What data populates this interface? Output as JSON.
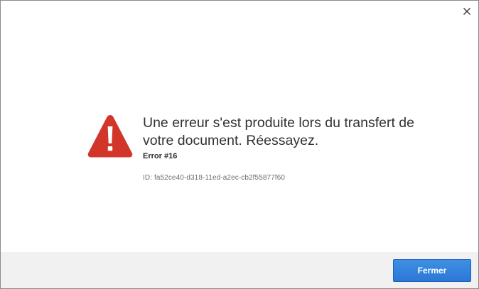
{
  "dialog": {
    "close_icon": "close-icon",
    "alert_icon": "warning-triangle-icon",
    "alert_color": "#d2362b",
    "message": "Une erreur s'est produite lors du transfert de votre document. Réessayez.",
    "error_code": "Error #16",
    "error_id": "ID: fa52ce40-d318-11ed-a2ec-cb2f55877f60"
  },
  "footer": {
    "primary_button_label": "Fermer",
    "primary_button_color": "#2b78d6"
  }
}
